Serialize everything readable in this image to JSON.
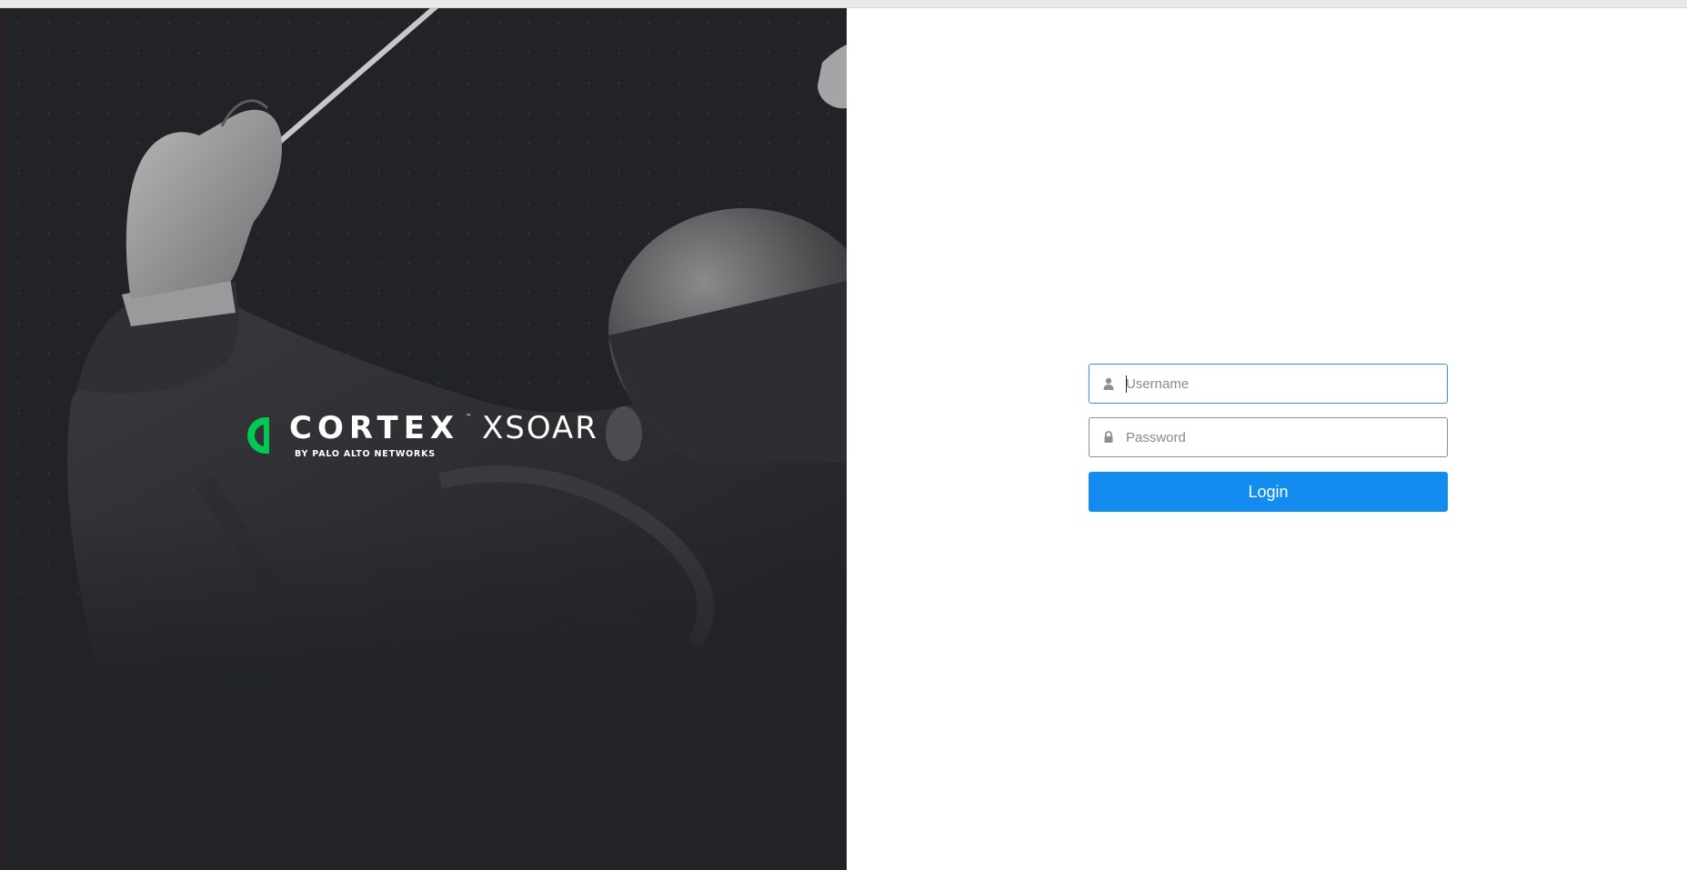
{
  "brand": {
    "name": "CORTEX",
    "trademark": "™",
    "product": "XSOAR",
    "byline": "BY PALO ALTO NETWORKS",
    "accent_color": "#00c853"
  },
  "login": {
    "username_placeholder": "Username",
    "password_placeholder": "Password",
    "username_icon": "user-icon",
    "password_icon": "lock-icon",
    "submit_label": "Login",
    "button_color": "#138cf0"
  }
}
